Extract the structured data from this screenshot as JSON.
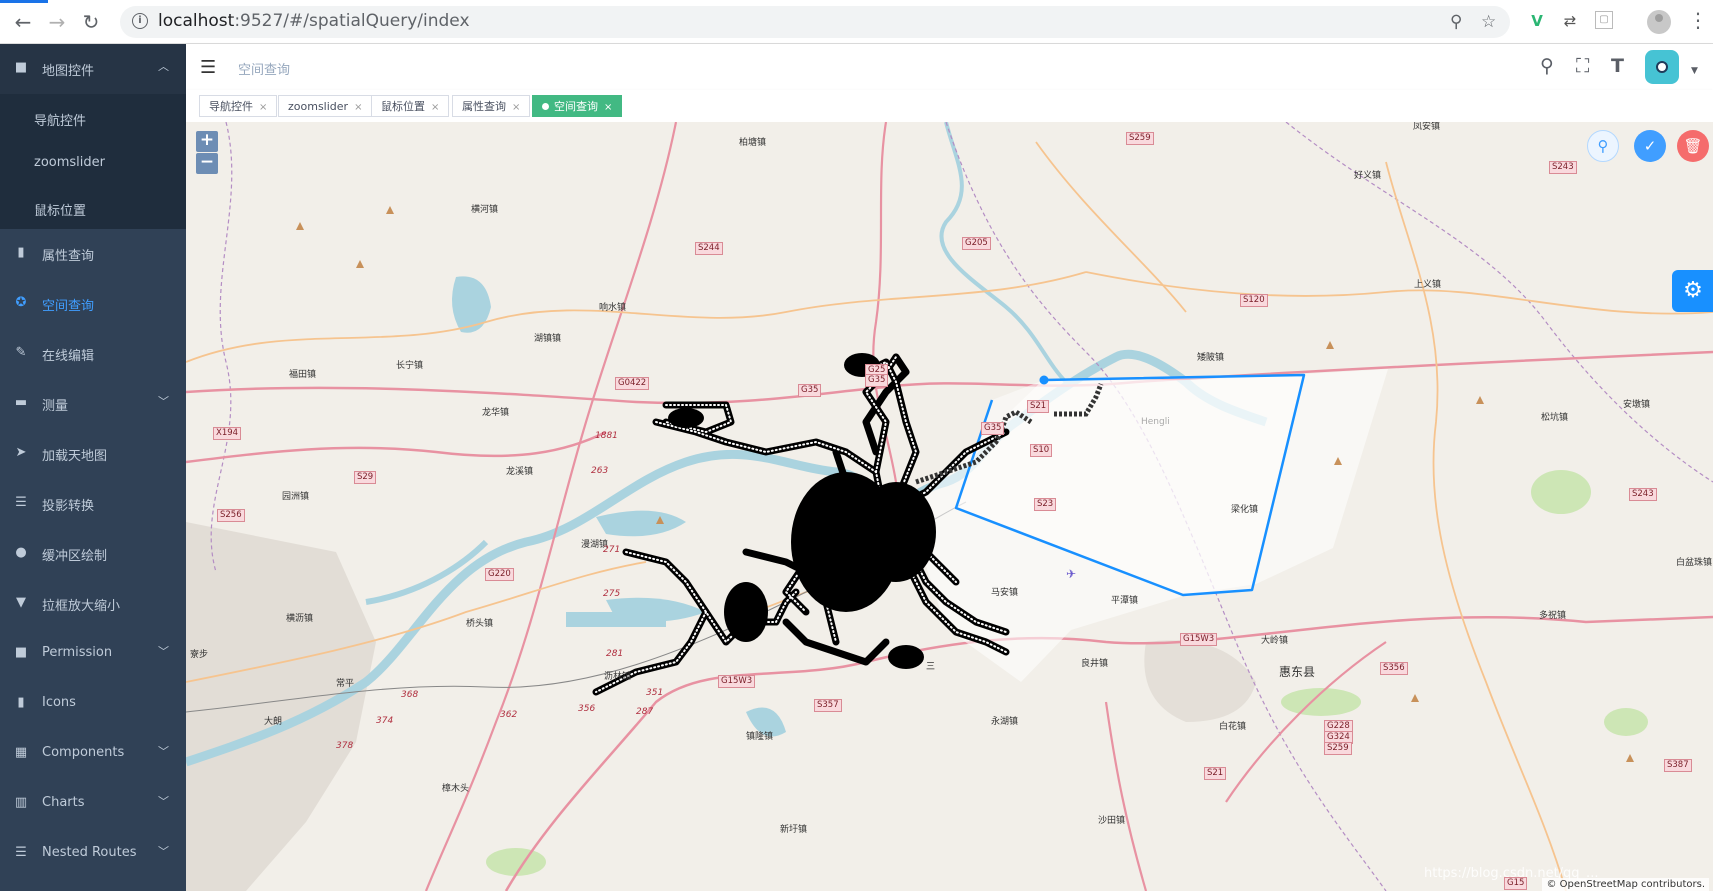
{
  "browser": {
    "url_host": "localhost",
    "url_path": ":9527/#/spatialQuery/index"
  },
  "sidebar": {
    "items": [
      {
        "label": "地图控件",
        "icon": "lock-icon",
        "expanded": true
      },
      {
        "label": "属性查询",
        "icon": "info-icon"
      },
      {
        "label": "空间查询",
        "icon": "crosshair-icon",
        "active": true
      },
      {
        "label": "在线编辑",
        "icon": "edit-icon"
      },
      {
        "label": "测量",
        "icon": "folder-icon",
        "has_children": true
      },
      {
        "label": "加载天地图",
        "icon": "send-icon"
      },
      {
        "label": "投影转换",
        "icon": "list-icon"
      },
      {
        "label": "缓冲区绘制",
        "icon": "user-icon"
      },
      {
        "label": "拉框放大缩小",
        "icon": "shirt-icon"
      },
      {
        "label": "Permission",
        "icon": "lock-icon",
        "has_children": true
      },
      {
        "label": "Icons",
        "icon": "info-icon"
      },
      {
        "label": "Components",
        "icon": "grid-icon",
        "has_children": true
      },
      {
        "label": "Charts",
        "icon": "bar-chart-icon",
        "has_children": true
      },
      {
        "label": "Nested Routes",
        "icon": "list-icon",
        "has_children": true
      }
    ],
    "submenu": [
      "导航控件",
      "zoomslider",
      "鼠标位置"
    ]
  },
  "navbar": {
    "breadcrumb": "空间查询"
  },
  "tags": [
    {
      "label": "导航控件"
    },
    {
      "label": "zoomslider"
    },
    {
      "label": "鼠标位置"
    },
    {
      "label": "属性查询"
    },
    {
      "label": "空间查询",
      "active": true
    }
  ],
  "map": {
    "zoom_in": "+",
    "zoom_out": "−",
    "attribution": "© OpenStreetMap contributors.",
    "watermark": "https://blog.csdn.net/qq_...",
    "labels": [
      "柏塘镇",
      "横河镇",
      "响水镇",
      "湖镇镇",
      "福田镇",
      "长宁镇",
      "龙华镇",
      "龙溪镇",
      "园洲镇",
      "横沥镇",
      "桥头镇",
      "漫湖镇",
      "常平",
      "大朗",
      "樟木头",
      "镇隆镇",
      "永湖镇",
      "良井镇",
      "平潭镇",
      "马安镇",
      "梁化镇",
      "白花镇",
      "大岭镇",
      "惠东县",
      "多祝镇",
      "松坑镇",
      "安墩镇",
      "白盆珠镇",
      "好义镇",
      "上义镇",
      "矮陂镇",
      "沥林镇",
      "沙田镇",
      "新圩镇",
      "寮步",
      "凤安镇",
      "Hengli",
      "三"
    ],
    "shields": [
      "S259",
      "S244",
      "G205",
      "S120",
      "G25",
      "G35",
      "G0422",
      "G35",
      "S21",
      "S10",
      "S23",
      "X194",
      "S29",
      "S256",
      "G220",
      "G15W3",
      "S357",
      "G15W3",
      "S356",
      "G228",
      "G324",
      "S259",
      "S21",
      "S243",
      "S243",
      "S387",
      "G15",
      "G35",
      "1881",
      "263",
      "271",
      "275",
      "281",
      "351",
      "362",
      "356",
      "287",
      "368",
      "374",
      "378"
    ]
  }
}
